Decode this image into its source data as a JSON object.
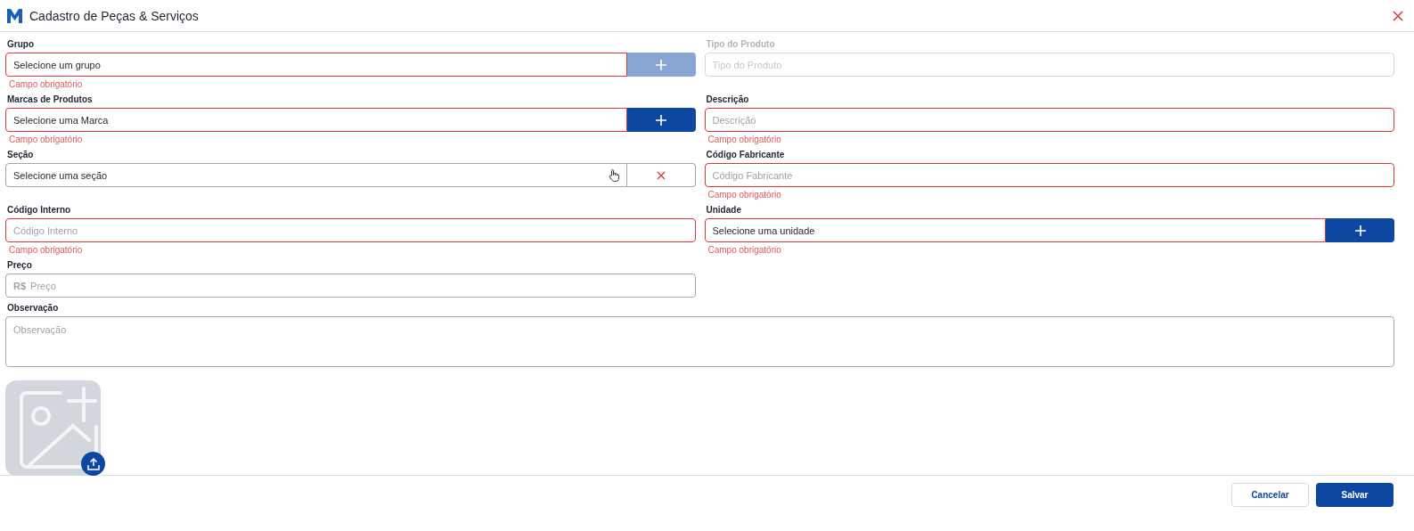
{
  "window": {
    "title": "Cadastro de Peças & Serviços"
  },
  "fields": [
    {
      "kind": "select",
      "label": "Grupo",
      "value": "Selecione um grupo",
      "error": "Campo obrigatório",
      "disabled": false,
      "action": {
        "kind": "add",
        "disabled": true
      }
    },
    {
      "kind": "text",
      "label": "Tipo do Produto",
      "placeholder": "Tipo do Produto",
      "disabled": true
    },
    {
      "kind": "select",
      "label": "Marcas de Produtos",
      "value": "Selecione uma Marca",
      "error": "Campo obrigatório",
      "disabled": false,
      "action": {
        "kind": "add",
        "disabled": false
      }
    },
    {
      "kind": "text",
      "label": "Descrição",
      "placeholder": "Descrição",
      "error": "Campo obrigatório",
      "disabled": false
    },
    {
      "kind": "select",
      "label": "Seção",
      "value": "Selecione uma seção",
      "disabled": false,
      "hovered": true,
      "action": {
        "kind": "clear",
        "disabled": false
      }
    },
    {
      "kind": "text",
      "label": "Código Fabricante",
      "placeholder": "Código Fabricante",
      "error": "Campo obrigatório",
      "disabled": false
    },
    {
      "kind": "text",
      "label": "Código Interno",
      "placeholder": "Código Interno",
      "error": "Campo obrigatório",
      "disabled": false
    },
    {
      "kind": "select",
      "label": "Unidade",
      "value": "Selecione uma unidade",
      "error": "Campo obrigatório",
      "disabled": false,
      "action": {
        "kind": "add",
        "disabled": false
      }
    },
    {
      "kind": "money",
      "label": "Preço",
      "prefix": "R$",
      "placeholder": "Preço",
      "disabled": false
    },
    {
      "kind": "textarea",
      "label": "Observação",
      "placeholder": "Observação",
      "disabled": false
    }
  ],
  "image_upload": {
    "kind": "picture-placeholder"
  },
  "buttons": [
    {
      "label": "Cancelar",
      "kind": "secondary"
    },
    {
      "label": "Salvar",
      "kind": "primary"
    }
  ]
}
